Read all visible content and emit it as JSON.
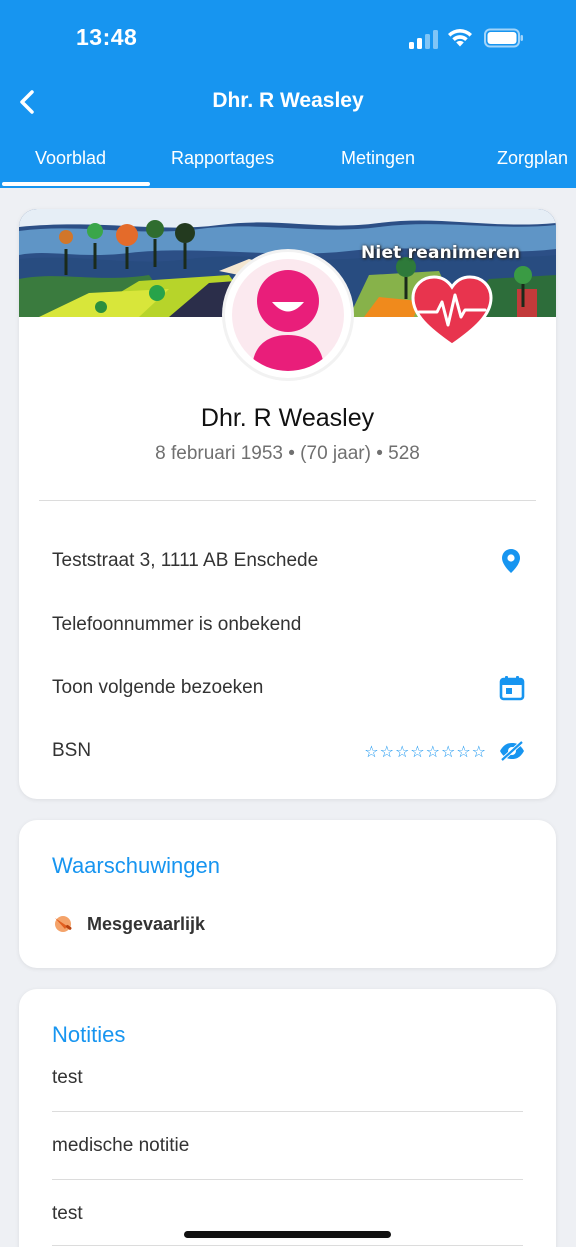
{
  "status_bar": {
    "time": "13:48"
  },
  "header": {
    "title": "Dhr. R Weasley"
  },
  "tabs": [
    {
      "label": "Voorblad",
      "active": true
    },
    {
      "label": "Rapportages",
      "active": false
    },
    {
      "label": "Metingen",
      "active": false
    },
    {
      "label": "Zorgplan",
      "active": false
    }
  ],
  "profile": {
    "dnr_label": "Niet reanimeren",
    "name": "Dhr. R Weasley",
    "meta": "8 februari 1953 • (70 jaar) • 528",
    "rows": {
      "address": "Teststraat 3, 1111 AB Enschede",
      "phone": "Telefoonnummer is onbekend",
      "visits": "Toon volgende bezoeken",
      "bsn_label": "BSN",
      "bsn_value": "☆☆☆☆☆☆☆☆"
    }
  },
  "warnings": {
    "title": "Waarschuwingen",
    "items": [
      {
        "label": "Mesgevaarlijk",
        "icon": "knife-icon"
      }
    ]
  },
  "notes": {
    "title": "Notities",
    "items": [
      "test",
      "medische notitie",
      "test"
    ]
  },
  "colors": {
    "accent": "#1795f0",
    "avatar": "#e91e7a",
    "heart": "#e8344e"
  }
}
